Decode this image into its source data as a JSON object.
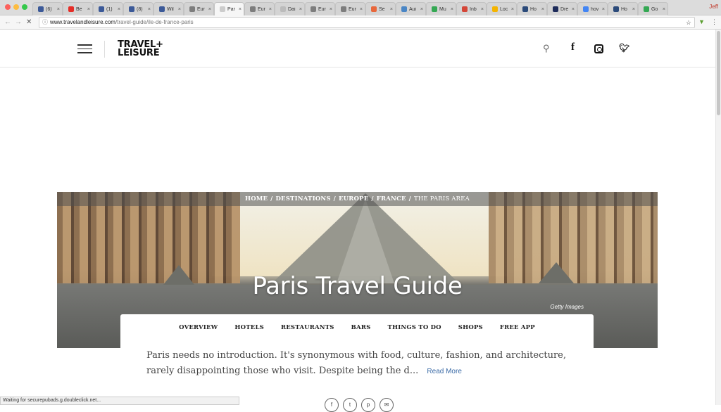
{
  "browser": {
    "tabs": [
      {
        "title": "(6)",
        "fav": "#3b5998"
      },
      {
        "title": "Be",
        "fav": "#e52d27"
      },
      {
        "title": "(1)",
        "fav": "#3b5998"
      },
      {
        "title": "(8)",
        "fav": "#3b5998"
      },
      {
        "title": "Wil",
        "fav": "#3b5998"
      },
      {
        "title": "Eur",
        "fav": "#7d7d7d"
      },
      {
        "title": "Par",
        "fav": "#cccccc",
        "active": true
      },
      {
        "title": "Eur",
        "fav": "#7d7d7d"
      },
      {
        "title": "Dai",
        "fav": "#bbbbbb"
      },
      {
        "title": "Eur",
        "fav": "#7d7d7d"
      },
      {
        "title": "Eur",
        "fav": "#7d7d7d"
      },
      {
        "title": "Se",
        "fav": "#e8673b"
      },
      {
        "title": "Aui",
        "fav": "#4a86c5"
      },
      {
        "title": "Mu",
        "fav": "#34a853"
      },
      {
        "title": "Inb",
        "fav": "#d44638"
      },
      {
        "title": "Loc",
        "fav": "#f4b400"
      },
      {
        "title": "Ho",
        "fav": "#2b4a7a"
      },
      {
        "title": "Dre",
        "fav": "#1d2b5a"
      },
      {
        "title": "hov",
        "fav": "#4285f4"
      },
      {
        "title": "Ho",
        "fav": "#2b4a7a"
      },
      {
        "title": "Go",
        "fav": "#34a853"
      }
    ],
    "profile": "Jeff",
    "url_host": "www.travelandleisure.com",
    "url_path": "/travel-guide/ile-de-france-paris",
    "status_text": "Waiting for securepubads.g.doubleclick.net..."
  },
  "header": {
    "logo_line1": "TRAVEL+",
    "logo_line2": "LEISURE"
  },
  "hero": {
    "breadcrumb": [
      "HOME",
      "DESTINATIONS",
      "EUROPE",
      "FRANCE",
      "THE PARIS AREA"
    ],
    "title": "Paris Travel Guide",
    "credit": "Getty Images"
  },
  "guide_nav": [
    "OVERVIEW",
    "HOTELS",
    "RESTAURANTS",
    "BARS",
    "THINGS TO DO",
    "SHOPS",
    "FREE APP"
  ],
  "intro": {
    "text": "Paris needs no introduction. It's synonymous with food, culture, fashion, and architecture, rarely disappointing those who visit. Despite being the d...",
    "read_more": "Read More"
  }
}
